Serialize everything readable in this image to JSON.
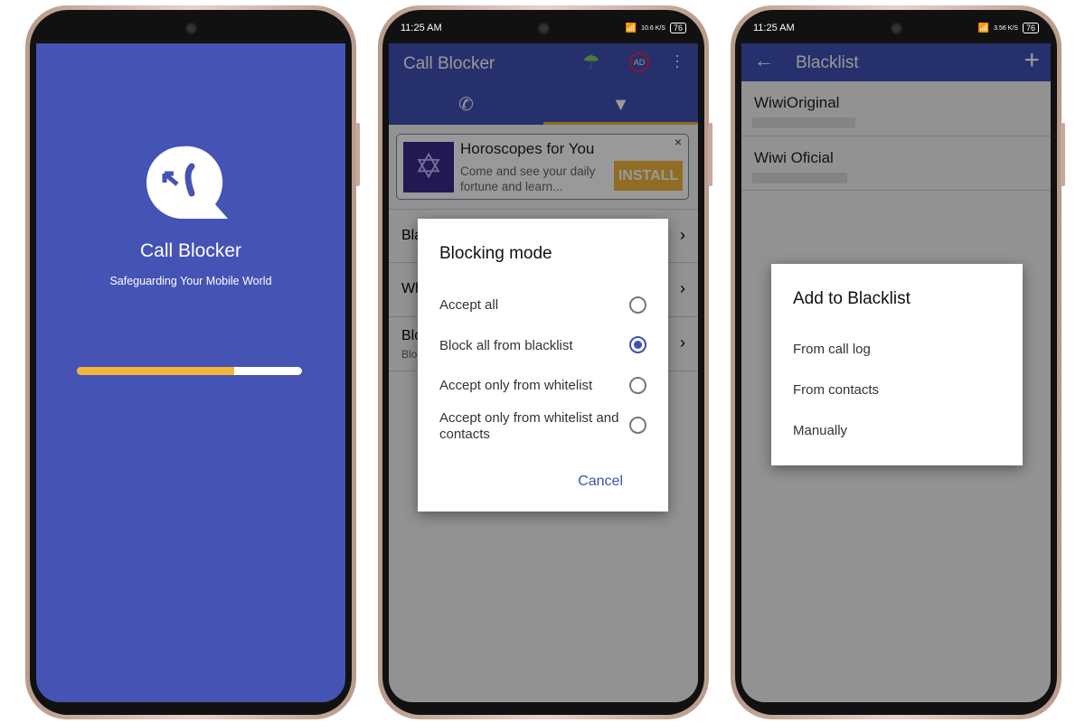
{
  "colors": {
    "primary": "#3f51b5",
    "splash_bg": "#4453b4",
    "accent": "#f0b43c"
  },
  "splash": {
    "app_name": "Call Blocker",
    "tagline": "Safeguarding Your Mobile World",
    "progress": 0.7,
    "logo_icon": "call-block-bubble-icon"
  },
  "status_bar": {
    "time": "11:25 AM",
    "battery": "76",
    "speed_phone2": "10.6 K/S",
    "speed_phone3": "3.56 K/S"
  },
  "main": {
    "title": "Call Blocker",
    "action_icons": [
      "umbrella-ad-icon",
      "no-ads-icon",
      "more-vert-icon"
    ],
    "tabs": [
      {
        "icon": "phone-icon"
      },
      {
        "icon": "filter-icon",
        "selected": true
      }
    ],
    "ad": {
      "title": "Horoscopes for You",
      "body": "Come and see your daily fortune and learn...",
      "cta": "INSTALL",
      "close": "×"
    },
    "rows": [
      {
        "label": "Bla"
      },
      {
        "label": "Wh"
      },
      {
        "label": "Blo",
        "sub": "Blo"
      }
    ],
    "dialog": {
      "title": "Blocking mode",
      "options": [
        {
          "label": "Accept all",
          "selected": false
        },
        {
          "label": "Block all from blacklist",
          "selected": true
        },
        {
          "label": "Accept only from whitelist",
          "selected": false
        },
        {
          "label": "Accept only from whitelist and contacts",
          "selected": false
        }
      ],
      "cancel": "Cancel"
    }
  },
  "blacklist": {
    "title": "Blacklist",
    "items": [
      {
        "name": "WiwiOriginal"
      },
      {
        "name": "Wiwi Oficial"
      }
    ],
    "dialog": {
      "title": "Add to Blacklist",
      "options": [
        "From call log",
        "From contacts",
        "Manually"
      ]
    }
  }
}
